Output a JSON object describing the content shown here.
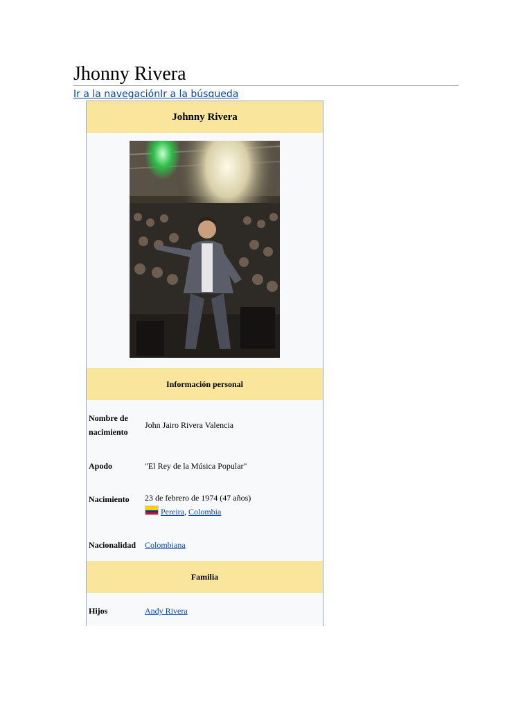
{
  "page": {
    "title": "Jhonny Rivera",
    "skip_links": [
      "Ir a la navegación",
      "Ir a la búsqueda"
    ]
  },
  "infobox": {
    "name": "Johnny Rivera",
    "photo": {
      "icon": "performer-photo"
    },
    "sections": {
      "personal": "Información personal",
      "family": "Familia"
    },
    "rows": {
      "birth_name": {
        "label": "Nombre de nacimiento",
        "value": "John Jairo Rivera Valencia"
      },
      "nickname": {
        "label": "Apodo",
        "value": "\"El Rey de la Música Popular\""
      },
      "birth": {
        "label": "Nacimiento",
        "date": "23 de febrero de 1974 (47 años)",
        "place_city": "Pereira",
        "separator": ", ",
        "place_country": "Colombia",
        "flag_icon": "colombia-flag-icon"
      },
      "nationality": {
        "label": "Nacionalidad",
        "value": "Colombiana"
      },
      "children": {
        "label": "Hijos",
        "value": "Andy Rivera"
      }
    }
  },
  "colors": {
    "header_bg": "#f9e59b",
    "infobox_bg": "#f8f9fa",
    "link": "#0645ad",
    "border": "#a2a9b1"
  }
}
